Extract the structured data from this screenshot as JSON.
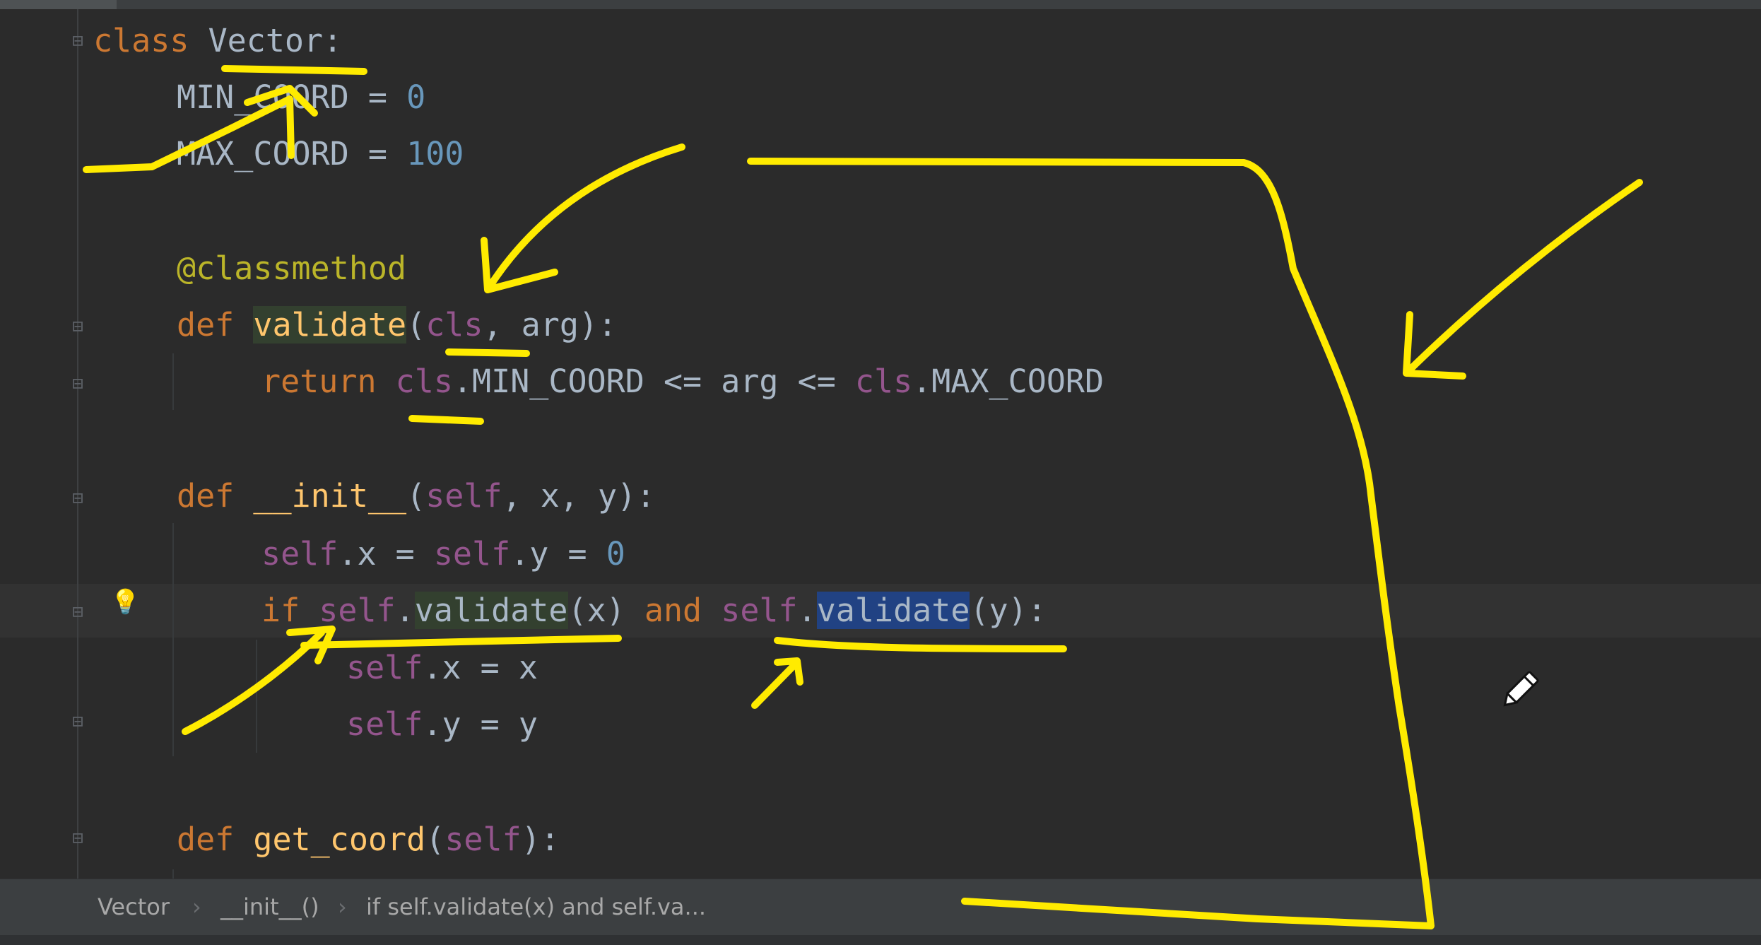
{
  "editor": {
    "lines": {
      "l1": {
        "kw": "class ",
        "name": "Vector",
        "punct": ":"
      },
      "l2": {
        "name": "MIN_COORD",
        "op": " = ",
        "val": "0"
      },
      "l3": {
        "name": "MAX_COORD",
        "op": " = ",
        "val": "100"
      },
      "l4": {
        "decorator": "@classmethod"
      },
      "l5": {
        "kw": "def ",
        "fn": "validate",
        "p1": "(",
        "cls": "cls",
        "rest": ", arg):"
      },
      "l6": {
        "kw": "return ",
        "cls1": "cls",
        "mid": ".MIN_COORD <= arg <= ",
        "cls2": "cls",
        "tail": ".MAX_COORD"
      },
      "l7": {
        "kw": "def ",
        "fn": "__init__",
        "p1": "(",
        "self": "self",
        "rest": ", x, y):"
      },
      "l8": {
        "self1": "self",
        "a": ".x = ",
        "self2": "self",
        "b": ".y = ",
        "val": "0"
      },
      "l9": {
        "kw": "if ",
        "self1": "self",
        "a": ".",
        "fn1": "validate",
        "b": "(x) ",
        "and": "and ",
        "self2": "self",
        "c": ".",
        "fn2": "validate",
        "d": "(y):"
      },
      "l10": {
        "self": "self",
        "rest": ".x = x"
      },
      "l11": {
        "self": "self",
        "rest": ".y = y"
      },
      "l12": {
        "kw": "def ",
        "fn": "get_coord",
        "p1": "(",
        "self": "self",
        "rest": "):"
      }
    }
  },
  "breadcrumb": {
    "items": [
      "Vector",
      "__init__()",
      "if self.validate(x) and self.va..."
    ],
    "separator": "›"
  },
  "icons": {
    "fold": "fold-marker-icon",
    "bulb": "lightbulb-icon",
    "cursor": "pencil-cursor-icon"
  },
  "colors": {
    "annotation": "#ffeb00",
    "keyword": "#cc7832",
    "function": "#ffc66d",
    "number": "#6897bb",
    "self": "#94558d",
    "selection": "#214283"
  }
}
